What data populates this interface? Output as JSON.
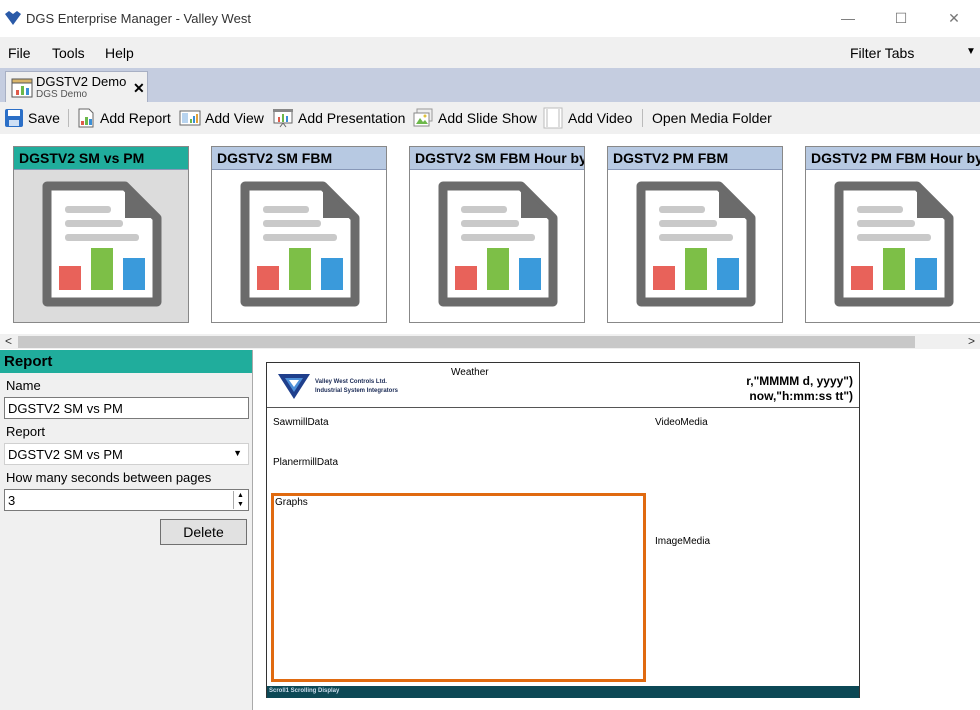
{
  "window": {
    "title": "DGS Enterprise Manager - Valley West",
    "minimize": "—",
    "maximize": "☐",
    "close": "✕"
  },
  "menu": {
    "file": "File",
    "tools": "Tools",
    "help": "Help",
    "filter_tabs": "Filter Tabs",
    "filter_arrow": "▼"
  },
  "doc_tab": {
    "title": "DGSTV2 Demo",
    "subtitle": "DGS Demo",
    "close": "✕"
  },
  "toolbar": {
    "save": "Save",
    "add_report": "Add Report",
    "add_view": "Add View",
    "add_presentation": "Add Presentation",
    "add_slide_show": "Add Slide Show",
    "add_video": "Add Video",
    "open_media_folder": "Open Media Folder"
  },
  "thumbnails": [
    {
      "label": "DGSTV2 SM vs PM",
      "selected": true
    },
    {
      "label": "DGSTV2 SM FBM",
      "selected": false
    },
    {
      "label": "DGSTV2 SM FBM Hour by",
      "selected": false
    },
    {
      "label": "DGSTV2 PM FBM",
      "selected": false
    },
    {
      "label": "DGSTV2 PM FBM Hour by",
      "selected": false
    }
  ],
  "scroll": {
    "left": "<",
    "right": ">"
  },
  "panel": {
    "header": "Report",
    "name_label": "Name",
    "name_value": "DGSTV2 SM vs PM",
    "report_label": "Report",
    "report_value": "DGSTV2 SM vs PM",
    "seconds_label": "How many seconds between pages",
    "seconds_value": "3",
    "delete": "Delete"
  },
  "preview": {
    "company_line1": "Valley West Controls Ltd.",
    "company_line2": "Industrial System Integrators",
    "weather": "Weather",
    "date_line1": "r,\"MMMM d, yyyy\")",
    "date_line2": "now,\"h:mm:ss tt\")",
    "sawmill": "SawmillData",
    "video": "VideoMedia",
    "planermill": "PlanermillData",
    "graphs": "Graphs",
    "image": "ImageMedia",
    "footer": "Scroll1  Scrolling  Display"
  },
  "colors": {
    "accent_teal": "#20ad9c",
    "thumb_header": "#b7c9e2",
    "graphs_border": "#e06a10",
    "footer_bar": "#0c4855"
  }
}
